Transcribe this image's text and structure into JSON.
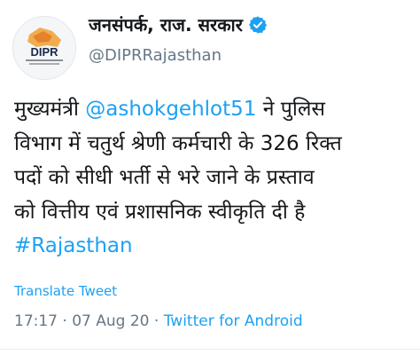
{
  "account": {
    "display_name": "जनसंपर्क, राज. सरकार",
    "handle": "@DIPRRajasthan",
    "avatar_text": "DIPR",
    "verified_icon": "verified-badge-icon",
    "verified_color": "#1da1f2"
  },
  "tweet": {
    "line1_pre": "मुख्यमंत्री ",
    "mention": "@ashokgehlot51",
    "line1_post": " ने पुलिस",
    "line2": "विभाग में चतुर्थ श्रेणी कर्मचारी के 326 रिक्त",
    "line3": "पदों को सीधी भर्ती से भरे जाने के प्रस्ताव",
    "line4": "को वित्तीय एवं प्रशासनिक स्वीकृति दी है",
    "hashtag": "#Rajasthan"
  },
  "actions": {
    "translate": "Translate Tweet"
  },
  "meta": {
    "time": "17:17",
    "separator": " · ",
    "date": "07 Aug 20",
    "source": "Twitter for Android"
  },
  "colors": {
    "link": "#1da1f2",
    "muted": "#657786",
    "text": "#14171a"
  }
}
